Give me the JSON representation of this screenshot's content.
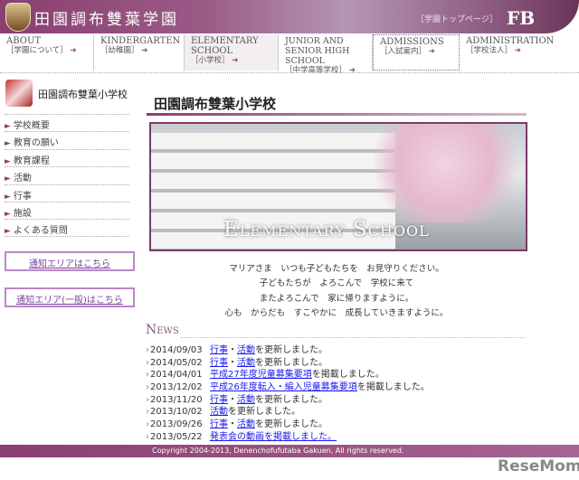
{
  "header": {
    "title": "田園調布雙葉学園",
    "top_link": "［学園トップページ］",
    "logo_text": "FB"
  },
  "nav": [
    {
      "en": "About",
      "ja": "［学園について］"
    },
    {
      "en": "Kindergarten",
      "ja": "［幼稚園］"
    },
    {
      "en": "Elementary School",
      "ja": "［小学校］"
    },
    {
      "en": "Junior and Senior High School",
      "ja": "［中学高等学校］"
    },
    {
      "en": "Admissions",
      "ja": "［入試案内］"
    },
    {
      "en": "Administration",
      "ja": "［学校法人］"
    }
  ],
  "sidebar": {
    "title": "田園調布雙葉小学校",
    "items": [
      "学校概要",
      "教育の願い",
      "教育課程",
      "活動",
      "行事",
      "施設",
      "よくある質問"
    ],
    "notice1": "通知エリアはこちら",
    "notice2": "通知エリア(一般)はこちら"
  },
  "main": {
    "title": "田園調布雙葉小学校",
    "hero_caption": "Elementary School",
    "message": [
      "マリアさま　いつも子どもたちを　お見守りください。",
      "子どもたちが　よろこんで　学校に来て",
      "またよろこんで　家に帰りますように。",
      "心も　からだも　すこやかに　成長していきますように。"
    ]
  },
  "news": {
    "heading": "News",
    "items": [
      {
        "date": "2014/09/03",
        "links": [
          "行事",
          "活動"
        ],
        "text": "を更新しました。"
      },
      {
        "date": "2014/05/02",
        "links": [
          "行事",
          "活動"
        ],
        "text": "を更新しました。"
      },
      {
        "date": "2014/04/01",
        "links": [
          "平成27年度児童募集要項"
        ],
        "text": "を掲載しました。"
      },
      {
        "date": "2013/12/02",
        "links": [
          "平成26年度転入・編入児童募集要項"
        ],
        "text": "を掲載しました。"
      },
      {
        "date": "2013/11/20",
        "links": [
          "行事",
          "活動"
        ],
        "text": "を更新しました。"
      },
      {
        "date": "2013/10/02",
        "links": [
          "活動"
        ],
        "text": "を更新しました。"
      },
      {
        "date": "2013/09/26",
        "links": [
          "行事",
          "活動"
        ],
        "text": "を更新しました。"
      },
      {
        "date": "2013/05/22",
        "links": [
          "発表会の動画を掲載しました。"
        ],
        "text": ""
      }
    ]
  },
  "footer": {
    "copyright": "Copyright  2004-2013,  Denenchofufutaba Gakuen, All rights reserved."
  },
  "watermark": "ReseMom"
}
